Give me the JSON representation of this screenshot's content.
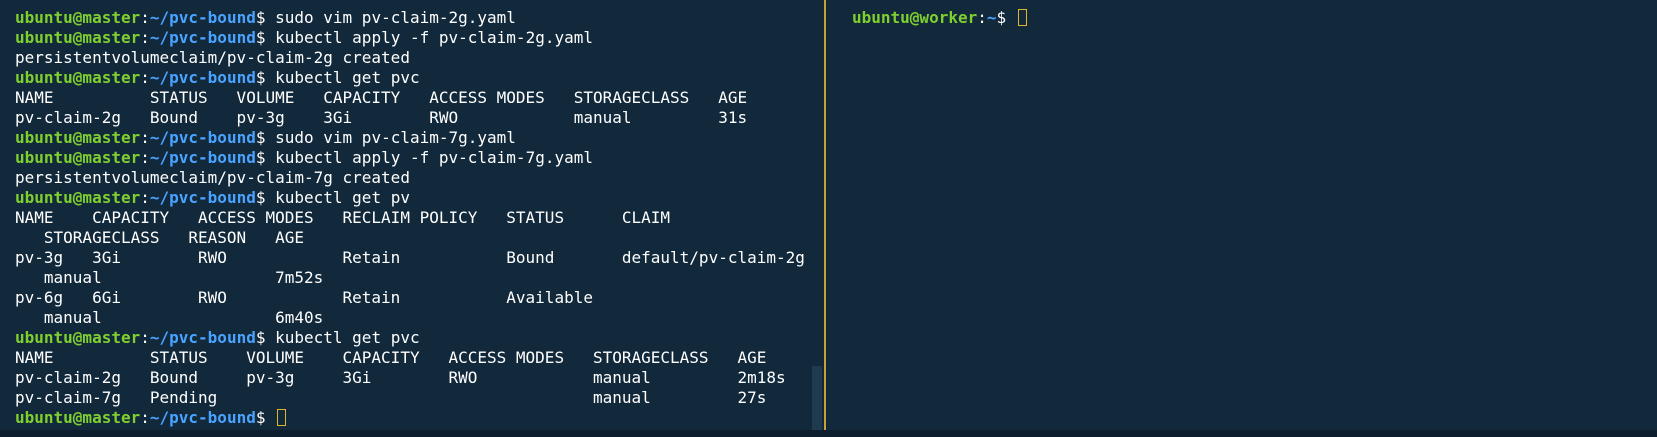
{
  "theme": {
    "background": "#12293c",
    "prompt_user_color": "#7fcf2f",
    "prompt_path_color": "#4aa3ff",
    "cursor_color": "#e0b530",
    "divider_color": "#c8a236"
  },
  "left_pane": {
    "lines": [
      {
        "type": "prompt",
        "user": "ubuntu@master",
        "sep": ":",
        "path": "~/pvc-bound",
        "dollar": "$ ",
        "cmd": "sudo vim pv-claim-2g.yaml"
      },
      {
        "type": "prompt",
        "user": "ubuntu@master",
        "sep": ":",
        "path": "~/pvc-bound",
        "dollar": "$ ",
        "cmd": "kubectl apply -f pv-claim-2g.yaml"
      },
      {
        "type": "output",
        "text": "persistentvolumeclaim/pv-claim-2g created"
      },
      {
        "type": "prompt",
        "user": "ubuntu@master",
        "sep": ":",
        "path": "~/pvc-bound",
        "dollar": "$ ",
        "cmd": "kubectl get pvc"
      },
      {
        "type": "output",
        "text": "NAME          STATUS   VOLUME   CAPACITY   ACCESS MODES   STORAGECLASS   AGE"
      },
      {
        "type": "output",
        "text": "pv-claim-2g   Bound    pv-3g    3Gi        RWO            manual         31s"
      },
      {
        "type": "prompt",
        "user": "ubuntu@master",
        "sep": ":",
        "path": "~/pvc-bound",
        "dollar": "$ ",
        "cmd": "sudo vim pv-claim-7g.yaml"
      },
      {
        "type": "prompt",
        "user": "ubuntu@master",
        "sep": ":",
        "path": "~/pvc-bound",
        "dollar": "$ ",
        "cmd": "kubectl apply -f pv-claim-7g.yaml"
      },
      {
        "type": "output",
        "text": "persistentvolumeclaim/pv-claim-7g created"
      },
      {
        "type": "prompt",
        "user": "ubuntu@master",
        "sep": ":",
        "path": "~/pvc-bound",
        "dollar": "$ ",
        "cmd": "kubectl get pv"
      },
      {
        "type": "output",
        "text": "NAME    CAPACITY   ACCESS MODES   RECLAIM POLICY   STATUS      CLAIM"
      },
      {
        "type": "output",
        "text": "   STORAGECLASS   REASON   AGE"
      },
      {
        "type": "output",
        "text": "pv-3g   3Gi        RWO            Retain           Bound       default/pv-claim-2g"
      },
      {
        "type": "output",
        "text": "   manual                  7m52s"
      },
      {
        "type": "output",
        "text": "pv-6g   6Gi        RWO            Retain           Available"
      },
      {
        "type": "output",
        "text": "   manual                  6m40s"
      },
      {
        "type": "prompt",
        "user": "ubuntu@master",
        "sep": ":",
        "path": "~/pvc-bound",
        "dollar": "$ ",
        "cmd": "kubectl get pvc"
      },
      {
        "type": "output",
        "text": "NAME          STATUS    VOLUME    CAPACITY   ACCESS MODES   STORAGECLASS   AGE"
      },
      {
        "type": "output",
        "text": "pv-claim-2g   Bound     pv-3g     3Gi        RWO            manual         2m18s"
      },
      {
        "type": "output",
        "text": "pv-claim-7g   Pending                                       manual         27s"
      },
      {
        "type": "prompt",
        "user": "ubuntu@master",
        "sep": ":",
        "path": "~/pvc-bound",
        "dollar": "$ ",
        "cmd": "",
        "cursor": true
      }
    ]
  },
  "right_pane": {
    "lines": [
      {
        "type": "prompt",
        "user": "ubuntu@worker",
        "sep": ":",
        "path": "~",
        "dollar": "$ ",
        "cmd": "",
        "cursor": true
      }
    ]
  }
}
